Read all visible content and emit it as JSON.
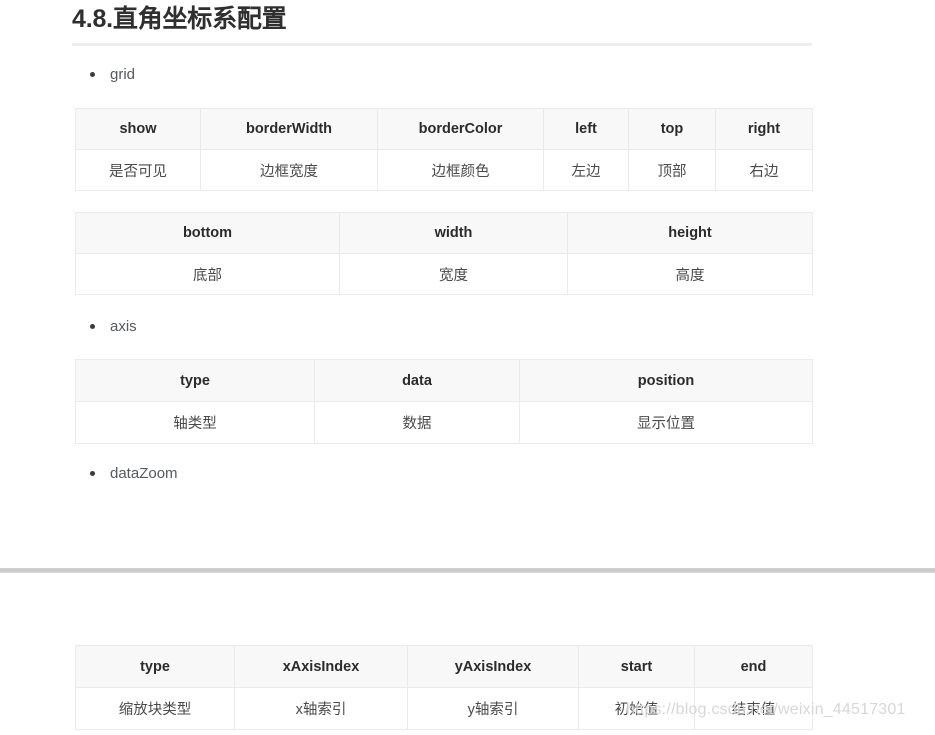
{
  "page": {
    "title": "4.8.直角坐标系配置",
    "watermark": "https://blog.csdn.net/weixin_44517301",
    "accent_border": "#eeeeee",
    "header_bg": "#f8f8f8",
    "border_color": "#e8ebed",
    "divider_color": "#cccccc",
    "bullet_text_color": "#555a5f"
  },
  "sections": [
    {
      "bullet": "grid",
      "tables": [
        {
          "name": "grid-table-1",
          "headers": [
            "show",
            "borderWidth",
            "borderColor",
            "left",
            "top",
            "right"
          ],
          "rows": [
            [
              "是否可见",
              "边框宽度",
              "边框颜色",
              "左边",
              "顶部",
              "右边"
            ]
          ]
        },
        {
          "name": "grid-table-2",
          "headers": [
            "bottom",
            "width",
            "height"
          ],
          "rows": [
            [
              "底部",
              "宽度",
              "高度"
            ]
          ]
        }
      ]
    },
    {
      "bullet": "axis",
      "tables": [
        {
          "name": "axis-table",
          "headers": [
            "type",
            "data",
            "position"
          ],
          "rows": [
            [
              "轴类型",
              "数据",
              "显示位置"
            ]
          ]
        }
      ]
    },
    {
      "bullet": "dataZoom",
      "tables": [
        {
          "name": "datazoom-table",
          "headers": [
            "type",
            "xAxisIndex",
            "yAxisIndex",
            "start",
            "end"
          ],
          "rows": [
            [
              "缩放块类型",
              "x轴索引",
              "y轴索引",
              "初始值",
              "结束值"
            ]
          ]
        }
      ]
    }
  ]
}
